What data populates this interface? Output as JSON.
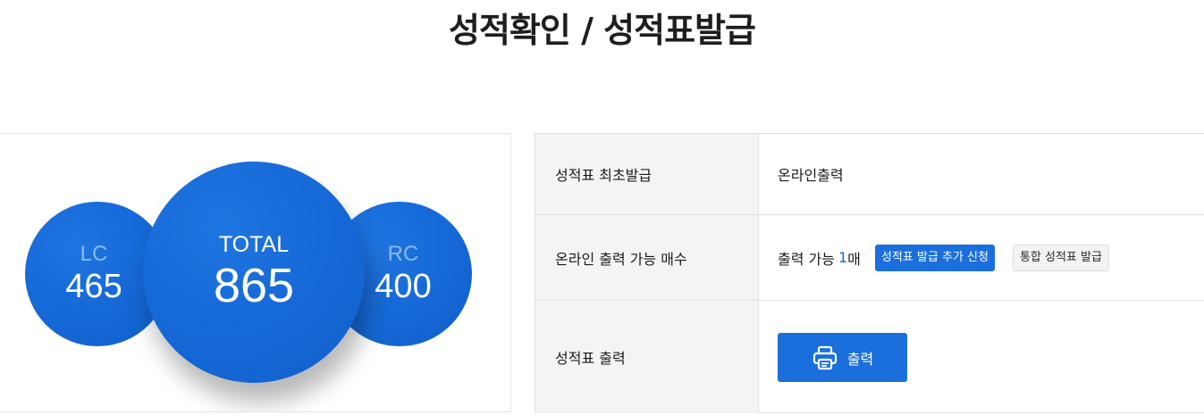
{
  "page": {
    "title": "성적확인 / 성적표발급"
  },
  "scores": {
    "lc": {
      "label": "LC",
      "value": "465"
    },
    "total": {
      "label": "TOTAL",
      "value": "865"
    },
    "rc": {
      "label": "RC",
      "value": "400"
    }
  },
  "table": {
    "rows": [
      {
        "label": "성적표 최초발급",
        "value": "온라인출력"
      },
      {
        "label": "온라인 출력 가능 매수",
        "value_prefix": "출력 가능",
        "count": "1",
        "unit": "매"
      },
      {
        "label": "성적표 출력"
      }
    ],
    "add_request_button": "성적표 발급 추가 신청",
    "integrated_button": "통합 성적표 발급",
    "print_button": "출력"
  },
  "icons": {
    "print": "printer-icon"
  },
  "colors": {
    "accent": "#1a6fdc",
    "circle": "#1568d6",
    "header_cell_bg": "#f4f4f4"
  }
}
